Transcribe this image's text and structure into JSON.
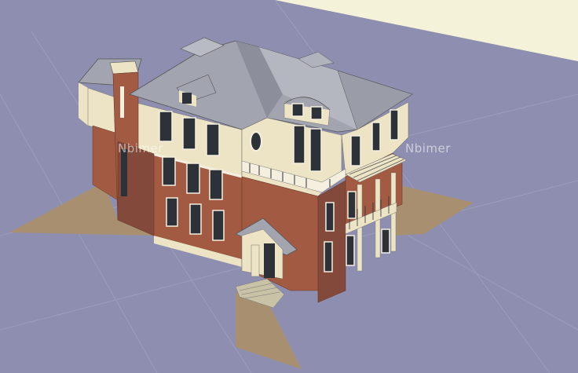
{
  "watermark": {
    "left_text": "Nbimer",
    "right_text": "Nbimer"
  },
  "colors": {
    "ground": "#8e8fb0",
    "sky": "#f4f3da",
    "shadow": "#a88f70",
    "brick": "#a35a43",
    "brick_dark": "#83493a",
    "stucco": "#ece4c4",
    "roof": "#a2a4b0",
    "roof_dark": "#8c8e9b",
    "window": "#2d3138",
    "trim": "#f4efdf"
  }
}
